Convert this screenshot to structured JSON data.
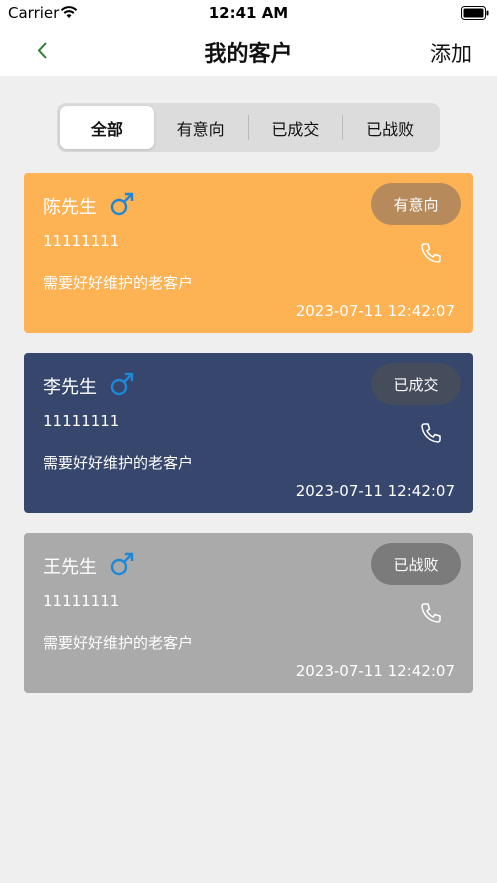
{
  "status_bar": {
    "carrier": "Carrier",
    "time": "12:41 AM"
  },
  "nav": {
    "title": "我的客户",
    "add_label": "添加"
  },
  "tabs": [
    {
      "label": "全部",
      "active": true
    },
    {
      "label": "有意向",
      "active": false
    },
    {
      "label": "已成交",
      "active": false
    },
    {
      "label": "已战败",
      "active": false
    }
  ],
  "customers": [
    {
      "name": "陈先生",
      "gender": "male",
      "status": "有意向",
      "phone": "11111111",
      "note": "需要好好维护的老客户",
      "time": "2023-07-11 12:42:07",
      "card_color": "#fdb254",
      "badge_color": "#b78a5c"
    },
    {
      "name": "李先生",
      "gender": "male",
      "status": "已成交",
      "phone": "11111111",
      "note": "需要好好维护的老客户",
      "time": "2023-07-11 12:42:07",
      "card_color": "#36466d",
      "badge_color": "#454c5c"
    },
    {
      "name": "王先生",
      "gender": "male",
      "status": "已战败",
      "phone": "11111111",
      "note": "需要好好维护的老客户",
      "time": "2023-07-11 12:42:07",
      "card_color": "#aaaaaa",
      "badge_color": "#7b7b7b"
    }
  ],
  "colors": {
    "gender_icon": "#1e88d8",
    "back_arrow": "#2e7d32"
  }
}
